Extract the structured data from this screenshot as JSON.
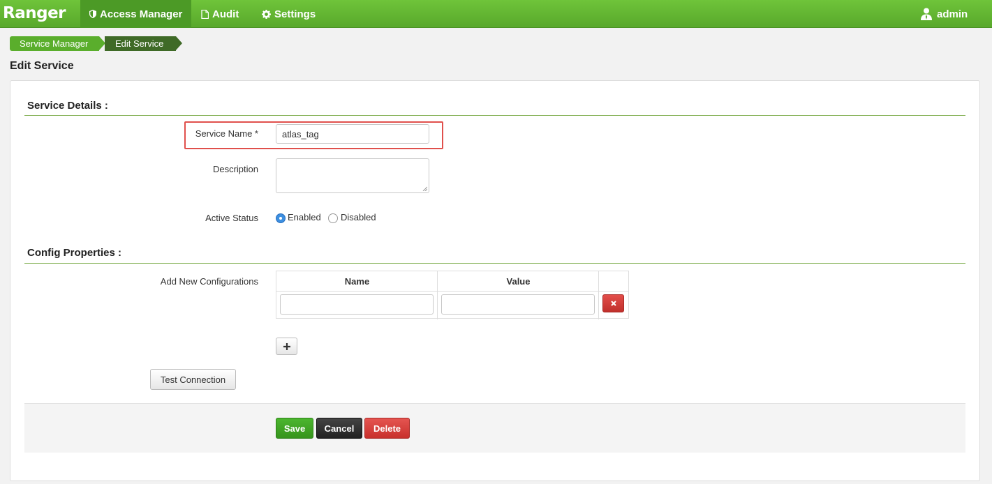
{
  "nav": {
    "brand": "Ranger",
    "items": [
      {
        "label": "Access Manager",
        "icon": "shield-icon",
        "active": true
      },
      {
        "label": "Audit",
        "icon": "file-icon",
        "active": false
      },
      {
        "label": "Settings",
        "icon": "gear-icon",
        "active": false
      }
    ],
    "user": {
      "label": "admin",
      "icon": "user-icon"
    }
  },
  "breadcrumb": [
    "Service Manager",
    "Edit Service"
  ],
  "page_title": "Edit Service",
  "service_details": {
    "title": "Service Details :",
    "service_name": {
      "label": "Service Name *",
      "value": "atlas_tag"
    },
    "description": {
      "label": "Description",
      "value": ""
    },
    "active_status": {
      "label": "Active Status",
      "options": [
        {
          "label": "Enabled",
          "checked": true
        },
        {
          "label": "Disabled",
          "checked": false
        }
      ]
    }
  },
  "config_properties": {
    "title": "Config Properties :",
    "add_label": "Add New Configurations",
    "columns": [
      "Name",
      "Value"
    ],
    "rows": [
      {
        "name": "",
        "value": ""
      }
    ]
  },
  "buttons": {
    "test_connection": "Test Connection",
    "save": "Save",
    "cancel": "Cancel",
    "delete": "Delete"
  },
  "colors": {
    "nav_green": "#58a82b",
    "active_tab": "#4c9a26",
    "highlight_red": "#e0504c",
    "save_green": "#36941c",
    "delete_red": "#c8302c"
  }
}
